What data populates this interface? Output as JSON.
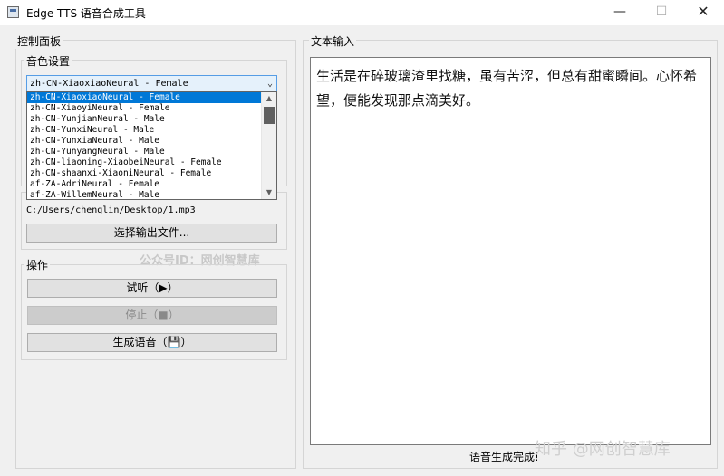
{
  "window": {
    "title": "Edge TTS 语音合成工具"
  },
  "left_panel": {
    "title": "控制面板",
    "voice_group": {
      "title": "音色设置",
      "selected_voice": "zh-CN-XiaoxiaoNeural - Female",
      "options": [
        "zh-CN-XiaoxiaoNeural - Female",
        "zh-CN-XiaoyiNeural - Female",
        "zh-CN-YunjianNeural - Male",
        "zh-CN-YunxiNeural - Male",
        "zh-CN-YunxiaNeural - Male",
        "zh-CN-YunyangNeural - Male",
        "zh-CN-liaoning-XiaobeiNeural - Female",
        "zh-CN-shaanxi-XiaoniNeural - Female",
        "af-ZA-AdriNeural - Female",
        "af-ZA-WillemNeural - Male"
      ]
    },
    "output": {
      "path": "C:/Users/chenglin/Desktop/1.mp3",
      "select_button": "选择输出文件..."
    },
    "actions_group": {
      "title": "操作",
      "listen_button": "试听（▶）",
      "stop_button": "停止（■）",
      "generate_button": "生成语音（💾）"
    }
  },
  "text_panel": {
    "title": "文本输入",
    "content": "生活是在碎玻璃渣里找糖，虽有苦涩，但总有甜蜜瞬间。心怀希望，便能发现那点滴美好。"
  },
  "status": "语音生成完成!",
  "watermarks": {
    "mid": "公众号ID：网创智慧库",
    "corner": "知乎 @网创智慧库"
  },
  "icons": {
    "window_icon": "app-icon",
    "minimize": "minimize-icon",
    "maximize": "maximize-icon",
    "close": "close-icon",
    "dropdown": "chevron-down-icon"
  }
}
